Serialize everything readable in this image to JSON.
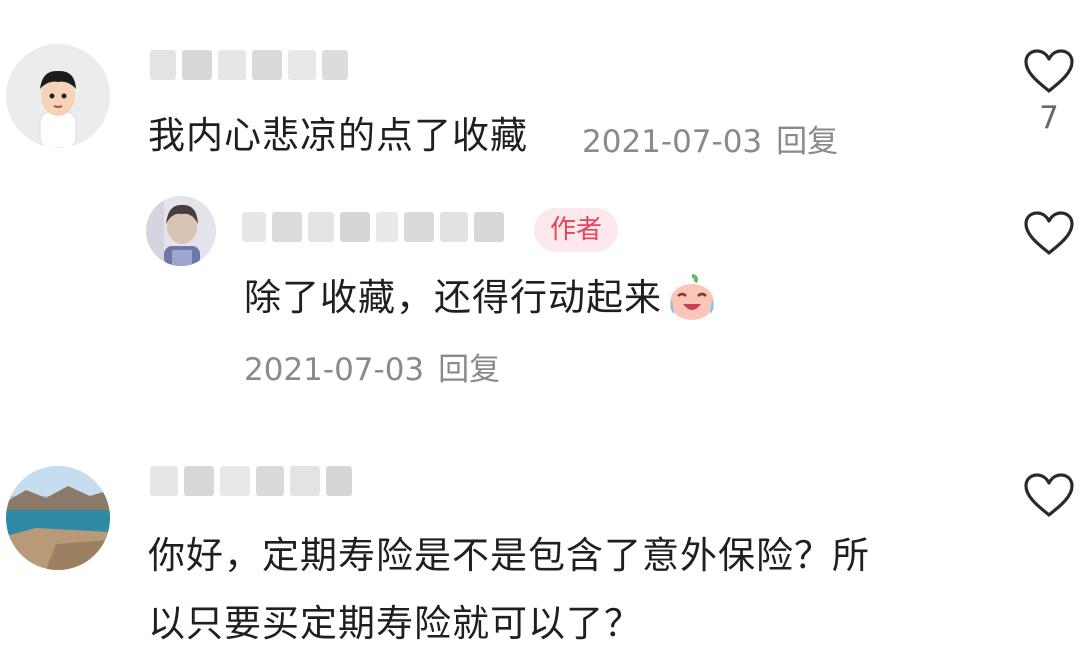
{
  "comments": [
    {
      "text": "我内心悲凉的点了收藏",
      "date": "2021-07-03",
      "reply_label": "回复",
      "like_count": "7",
      "avatar_icon": "boy-cartoon-avatar"
    },
    {
      "text": "除了收藏，还得行动起来",
      "emoji": "crying-laughing-emoji",
      "date": "2021-07-03",
      "reply_label": "回复",
      "badge": "作者",
      "avatar_icon": "person-photo-avatar"
    },
    {
      "text_line1": "你好，定期寿险是不是包含了意外保险？所",
      "text_line2": "以只要买定期寿险就可以了？",
      "avatar_icon": "lake-landscape-avatar"
    }
  ],
  "colors": {
    "badge_bg": "#fde9ec",
    "badge_text": "#e8435a",
    "meta_text": "#8a8a8a"
  }
}
